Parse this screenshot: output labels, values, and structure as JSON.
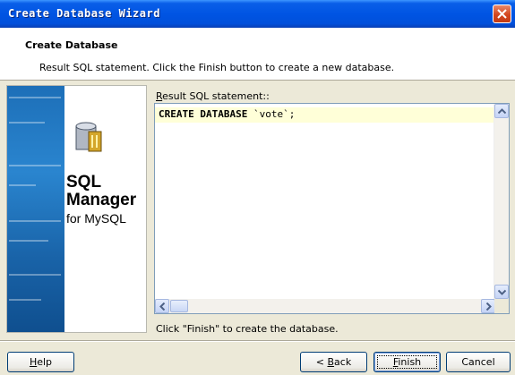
{
  "window": {
    "title": "Create Database Wizard"
  },
  "header": {
    "title": "Create Database",
    "description": "Result SQL statement. Click the Finish button to create a new database."
  },
  "banner": {
    "product_line1": "SQL",
    "product_line2": "Manager",
    "product_line3": "for MySQL"
  },
  "editor": {
    "label_prefix": "R",
    "label_rest": "esult SQL statement::",
    "keyword": "CREATE DATABASE",
    "value": " `vote`;"
  },
  "hint": "Click \"Finish\" to create the database.",
  "buttons": {
    "help_u": "H",
    "help_rest": "elp",
    "back_pre": "< ",
    "back_u": "B",
    "back_rest": "ack",
    "finish_u": "F",
    "finish_rest": "inish",
    "cancel": "Cancel"
  },
  "colors": {
    "titlebar": "#0054e3",
    "dialog_bg": "#ece9d8",
    "editor_highlight": "#ffffd8"
  }
}
